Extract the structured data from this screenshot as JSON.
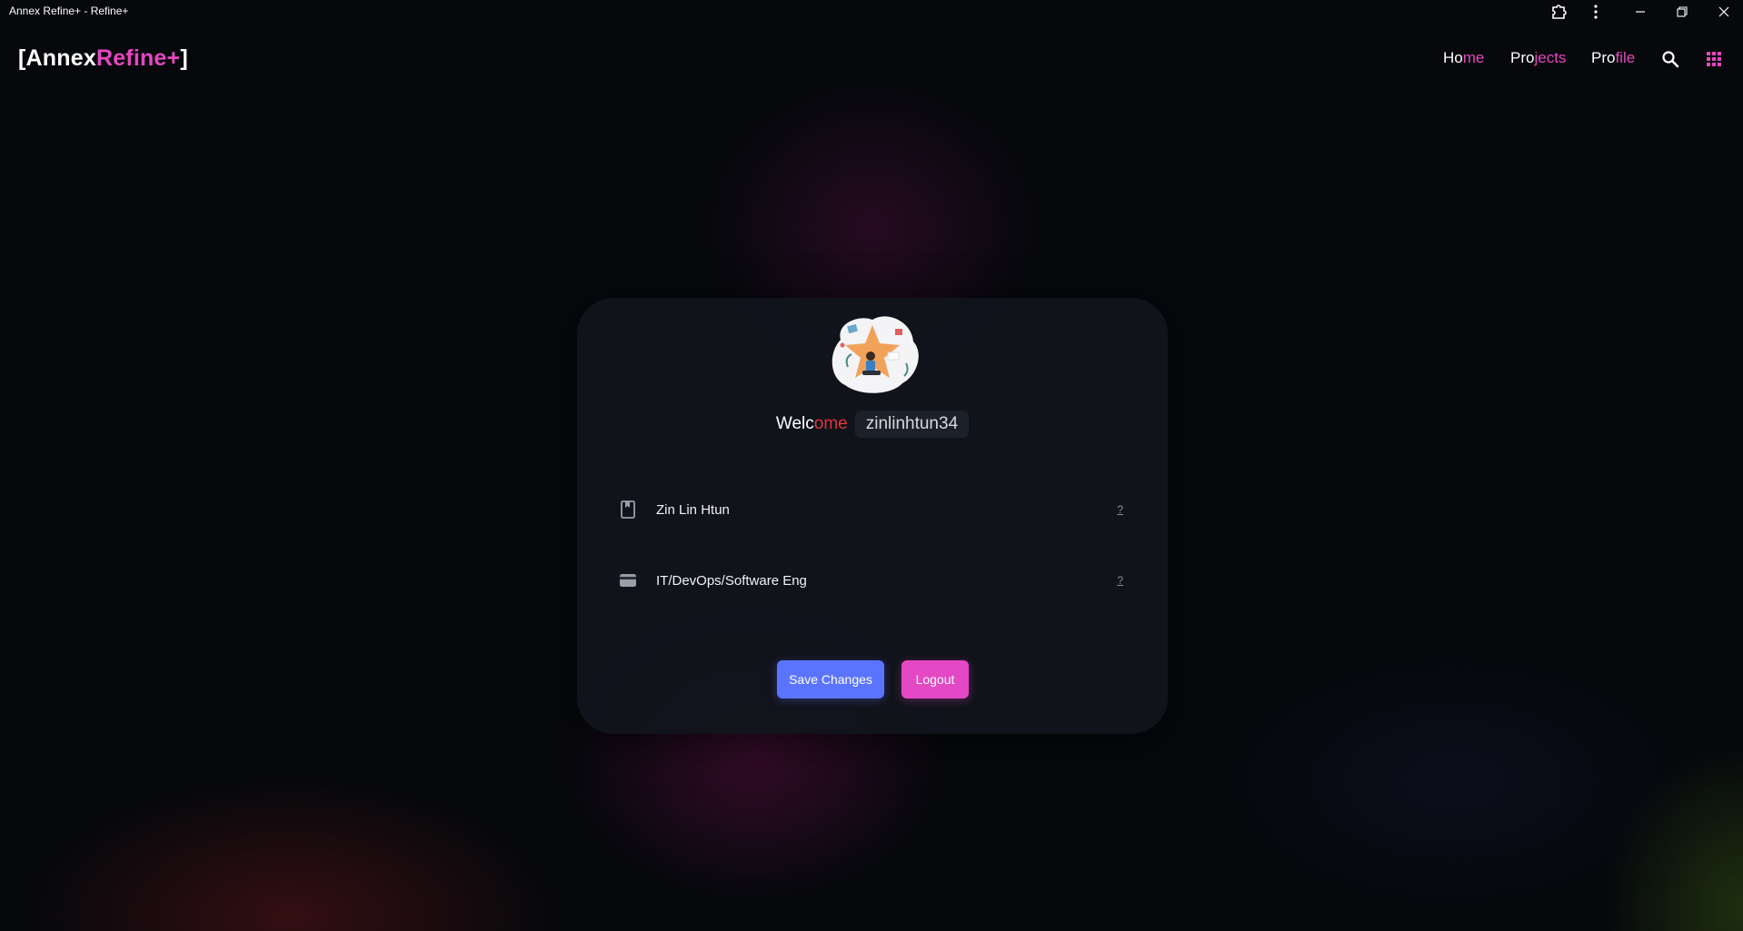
{
  "window": {
    "title": "Annex Refine+ - Refine+"
  },
  "header": {
    "logo_open": "[",
    "logo_part1": "Annex",
    "logo_part2": "Refine+",
    "logo_close": "]",
    "nav": {
      "home_a": "Ho",
      "home_b": "me",
      "projects_a": "Pro",
      "projects_b": "jects",
      "profile_a": "Pro",
      "profile_b": "file"
    }
  },
  "profile": {
    "welcome_a": "Welc",
    "welcome_b": "ome",
    "username": "zinlinhtun34",
    "fields": [
      {
        "icon": "bookmark-icon",
        "value": "Zin Lin Htun",
        "help": "?"
      },
      {
        "icon": "id-card-icon",
        "value": "IT/DevOps/Software Eng",
        "help": "?"
      }
    ],
    "save_label": "Save Changes",
    "logout_label": "Logout"
  },
  "colors": {
    "accent_pink": "#e547bf",
    "accent_blue": "#5b74ff",
    "welcome_red": "#e0353c",
    "background": "#06080c"
  }
}
